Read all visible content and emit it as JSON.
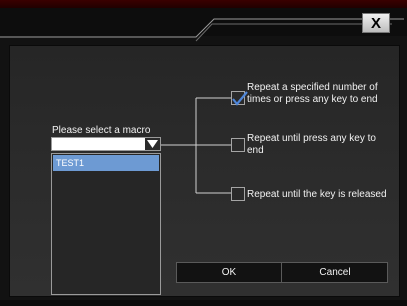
{
  "window": {
    "close_label": "X"
  },
  "macro": {
    "label": "Please select a macro",
    "selected_value": "",
    "items": [
      "TEST1"
    ]
  },
  "options": [
    {
      "label_line1": "Repeat a specified number of",
      "label_line2": "times or press any key to end",
      "checked": true
    },
    {
      "label_line1": "Repeat until press any key to",
      "label_line2": "end",
      "checked": false
    },
    {
      "label_line1": "Repeat until the key is released",
      "label_line2": "",
      "checked": false
    }
  ],
  "buttons": {
    "ok_label": "OK",
    "cancel_label": "Cancel"
  },
  "colors": {
    "accent": "#6d9ad3",
    "background": "#121212"
  }
}
